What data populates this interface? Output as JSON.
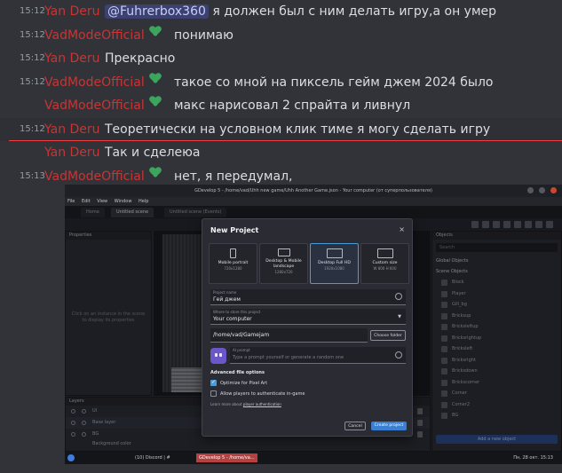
{
  "chat": {
    "messages": [
      {
        "time": "15:12",
        "author": "Yan Deru",
        "mention": "@Fuhrerbox360",
        "text": "я должен был с ним делать игру,а он умер",
        "badge": false,
        "highlight": false
      },
      {
        "time": "15:12",
        "author": "VadModeOfficial",
        "mention": "",
        "text": "понимаю",
        "badge": true,
        "highlight": false
      },
      {
        "time": "15:12",
        "author": "Yan Deru",
        "mention": "",
        "text": "Прекрасно",
        "badge": false,
        "highlight": false
      },
      {
        "time": "15:12",
        "author": "VadModeOfficial",
        "mention": "",
        "text": "такое со мной на пиксель гейм джем 2024 было",
        "badge": true,
        "highlight": false
      },
      {
        "time": "",
        "author": "VadModeOfficial",
        "mention": "",
        "text": "макс нарисовал 2 спрайта и ливнул",
        "badge": true,
        "highlight": false
      },
      {
        "time": "15:12",
        "author": "Yan Deru",
        "mention": "",
        "text": "Теоретически на условном клик тиме я могу сделать игру",
        "badge": false,
        "highlight": true
      },
      {
        "time": "",
        "author": "Yan Deru",
        "mention": "",
        "text": "Так и сделеюа",
        "badge": false,
        "highlight": false
      },
      {
        "time": "15:13",
        "author": "VadModeOfficial",
        "mention": "",
        "text": "нет, я передумал,",
        "badge": true,
        "highlight": false
      }
    ],
    "badge_color": "#3ba55d",
    "author_color": "#c93434"
  },
  "screenshot": {
    "window_title": "GDevelop 5 - /home/vad/Uhh new game/Uhh Another Game.json - Your computer (от суперпользователя)",
    "menu": [
      "File",
      "Edit",
      "View",
      "Window",
      "Help"
    ],
    "tabs": [
      "Home",
      "Untitled scene",
      "Untitled scene (Events)"
    ],
    "properties_title": "Properties",
    "properties_hint": "Click on an instance in the scene to display its properties",
    "layers_title": "Layers",
    "layers": [
      "UI",
      "Base layer",
      "BG",
      "Background color"
    ],
    "objects_title": "Objects",
    "objects_search": "Search",
    "global_objects": "Global Objects",
    "scene_objects": "Scene Objects",
    "objects": [
      "Block",
      "Player",
      "Gill_bg",
      "Bricksup",
      "Bricksleftup",
      "Bricksrightup",
      "Bricksleft",
      "Bricksright",
      "Bricksdown",
      "Brickscorner",
      "Corner",
      "Corner2",
      "BG"
    ],
    "add_object": "Add a new object",
    "taskbar": {
      "discord": "(10) Discord | #",
      "gdevelop": "GDevelop 5 - /home/va...",
      "clock": "Пн, 28 окт. 15:13"
    },
    "modal": {
      "title": "New Project",
      "close": "×",
      "presets": [
        {
          "name": "Mobile portrait",
          "res": "720x1280",
          "selected": false
        },
        {
          "name": "Desktop & Mobile landscape",
          "res": "1280x720",
          "selected": false
        },
        {
          "name": "Desktop Full HD",
          "res": "1920x1080",
          "selected": true
        },
        {
          "name": "Custom size",
          "res": "W 800   H 600",
          "selected": false
        }
      ],
      "project_name_label": "Project name",
      "project_name_value": "Гей джем",
      "store_label": "Where to store this project",
      "store_value": "Your computer",
      "folder_path": "/home/vad/Gamejam",
      "choose_folder": "Choose folder",
      "ai_label": "AI prompt",
      "ai_placeholder": "Type a prompt yourself or generate a random one",
      "advanced": "Advanced file options",
      "optimize": "Optimize for Pixel Art",
      "optimize_checked": true,
      "allow_auth": "Allow players to authenticate in-game",
      "allow_auth_checked": false,
      "learn_more_prefix": "Learn more about ",
      "learn_more_link": "player authentication",
      "cancel": "Cancel",
      "create": "Create project"
    }
  }
}
